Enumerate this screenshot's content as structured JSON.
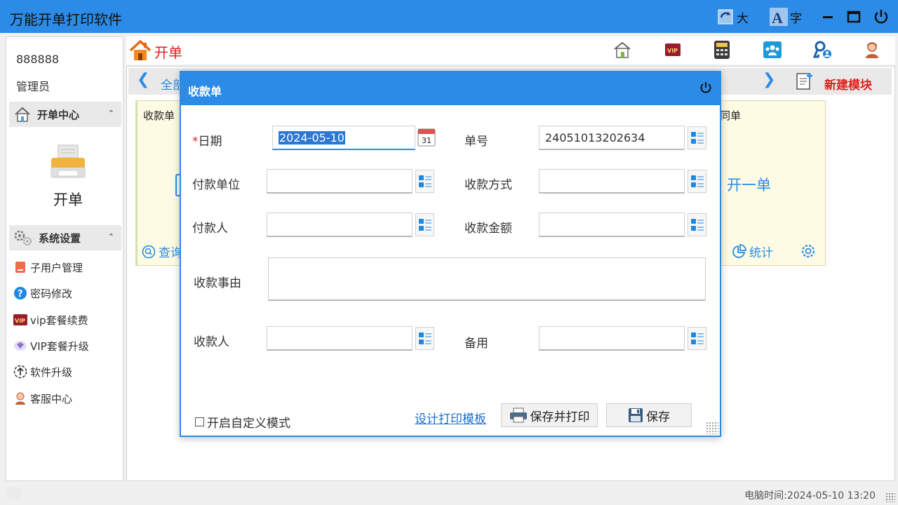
{
  "window": {
    "title": "万能开单打印软件",
    "text_size_large_label": "大",
    "font_label": "字",
    "accent_color": "#2b8be6"
  },
  "sidebar": {
    "user_id": "888888",
    "role": "管理员",
    "section_billing": "开单中心",
    "open_bill_label": "开单",
    "section_settings": "系统设置",
    "items": [
      {
        "label": "子用户管理",
        "icon": "user-manage-icon"
      },
      {
        "label": "密码修改",
        "icon": "question-icon"
      },
      {
        "label": "vip套餐续费",
        "icon": "vip-icon"
      },
      {
        "label": "VIP套餐升级",
        "icon": "diamond-icon"
      },
      {
        "label": "软件升级",
        "icon": "upgrade-icon"
      },
      {
        "label": "客服中心",
        "icon": "support-icon"
      }
    ]
  },
  "header": {
    "title": "开单",
    "icons": [
      "home-icon",
      "vip-icon",
      "calculator-icon",
      "team-icon",
      "user-key-icon",
      "support-agent-icon"
    ]
  },
  "nav": {
    "all_tab": "全部",
    "new_module": "新建模块"
  },
  "cards": {
    "left_name": "收款单",
    "right_name": "同单",
    "open_one": "开一单",
    "query": "查询",
    "stats": "统计"
  },
  "status": {
    "clock": "电脑时间:2024-05-10 13:20"
  },
  "dialog": {
    "title": "收款单",
    "fields": {
      "date_label": "日期",
      "date_value": "2024-05-10",
      "calendar_day": "31",
      "number_label": "单号",
      "number_value": "24051013202634",
      "payer_unit_label": "付款单位",
      "payer_unit_value": "",
      "method_label": "收款方式",
      "method_value": "",
      "payer_label": "付款人",
      "payer_value": "",
      "amount_label": "收款金额",
      "amount_value": "",
      "reason_label": "收款事由",
      "reason_value": "",
      "receiver_label": "收款人",
      "receiver_value": "",
      "spare_label": "备用",
      "spare_value": ""
    },
    "custom_mode_label": "开启自定义模式",
    "custom_mode_checked": false,
    "design_link": "设计打印模板",
    "save_print_label": "保存并打印",
    "save_label": "保存"
  }
}
